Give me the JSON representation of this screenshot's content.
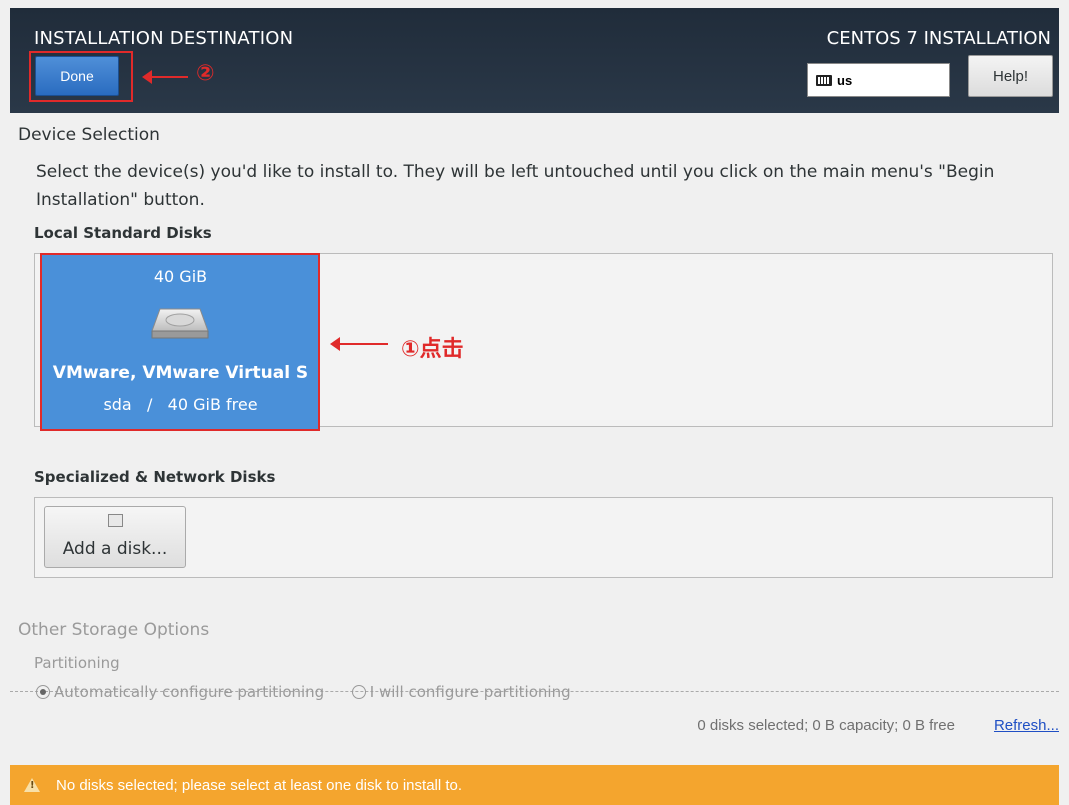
{
  "header": {
    "title": "INSTALLATION DESTINATION",
    "product": "CENTOS 7 INSTALLATION",
    "done_label": "Done",
    "keyboard_layout": "us",
    "help_label": "Help!"
  },
  "device_selection": {
    "title": "Device Selection",
    "description": "Select the device(s) you'd like to install to.  They will be left untouched until you click on the main menu's \"Begin Installation\" button."
  },
  "local_disks": {
    "heading": "Local Standard Disks",
    "disks": [
      {
        "size": "40 GiB",
        "name": "VMware, VMware Virtual S",
        "device": "sda",
        "sep": "/",
        "free": "40 GiB free"
      }
    ]
  },
  "network_disks": {
    "heading": "Specialized & Network Disks",
    "add_label": "Add a disk..."
  },
  "other_storage": {
    "title": "Other Storage Options",
    "partitioning": "Partitioning",
    "auto_option": "Automatically configure partitioning",
    "manual_option": "I will configure partitioning"
  },
  "summary": {
    "text": "0 disks selected; 0 B capacity; 0 B free",
    "refresh": "Refresh..."
  },
  "warning": {
    "text": "No disks selected; please select at least one disk to install to."
  },
  "annotations": {
    "step1": "①点击",
    "step2": "②"
  },
  "colors": {
    "header_bg": "#202c3a",
    "selected_disk": "#4a90d9",
    "warning_bar": "#f4a52e",
    "annotation_red": "#e02a2a",
    "link": "#1f4fc4"
  }
}
